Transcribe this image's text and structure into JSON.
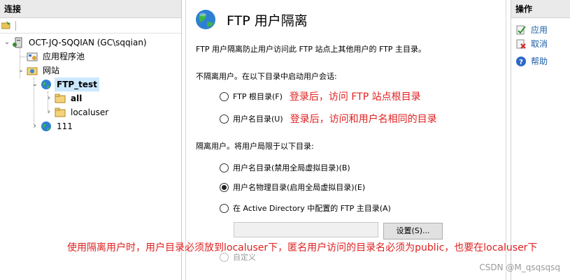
{
  "connections": {
    "header": "连接",
    "tree": {
      "server": "OCT-JQ-SQQIAN (GC\\sqqian)",
      "app_pools": "应用程序池",
      "sites": "网站",
      "site_ftp": "FTP_test",
      "folder_all": "all",
      "folder_localuser": "localuser",
      "site_111": "111"
    }
  },
  "main": {
    "title": "FTP 用户隔离",
    "description": "FTP 用户隔离防止用户访问此 FTP 站点上其他用户的 FTP 主目录。",
    "no_isolate_label": "不隔离用户。在以下目录中启动用户会话:",
    "opt_ftp_root": "FTP 根目录(F)",
    "annot_ftp_root": "登录后，访问 FTP 站点根目录",
    "opt_username_dir": "用户名目录(U)",
    "annot_username_dir": "登录后，访问和用户名相同的目录",
    "isolate_label": "隔离用户。将用户局限于以下目录:",
    "opt_username_dir_nv": "用户名目录(禁用全局虚拟目录)(B)",
    "opt_username_physical": "用户名物理目录(启用全局虚拟目录)(E)",
    "opt_active_directory": "在 Active Directory 中配置的 FTP 主目录(A)",
    "settings_button": "设置(S)...",
    "opt_custom": "自定义",
    "selected_option": "opt_username_physical"
  },
  "actions": {
    "header": "操作",
    "apply": "应用",
    "cancel": "取消",
    "help": "帮助"
  },
  "overlay_note": "使用隔离用户时，用户目录必须放到localuser下，匿名用户访问的目录名必须为public，也要在localuser下",
  "watermark": "CSDN @M_qsqsqsq",
  "colors": {
    "annotation": "#e02020",
    "selection": "#cce8ff",
    "link": "#1e5fa8"
  }
}
